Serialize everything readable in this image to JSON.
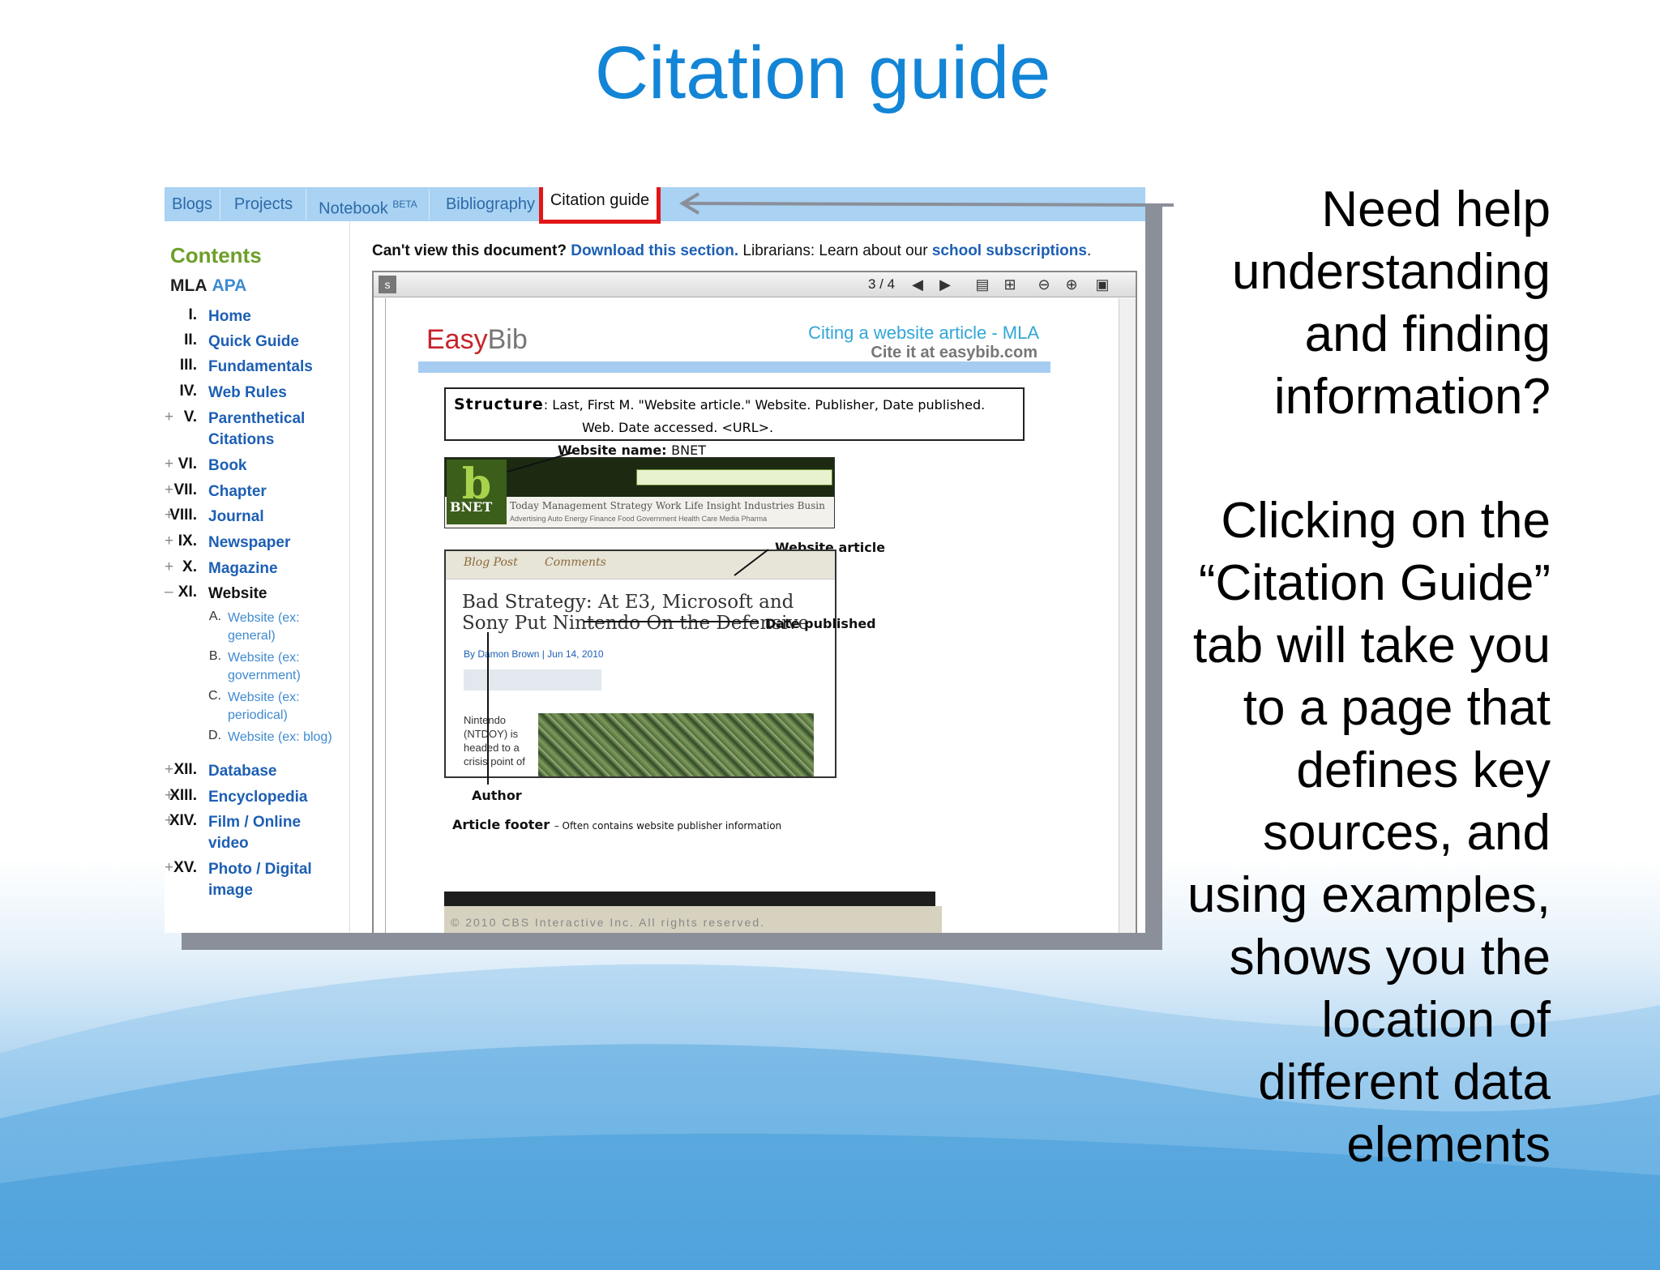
{
  "slide": {
    "title": "Citation guide",
    "side_text_1": [
      "Need help",
      "understanding",
      "and finding",
      "information?"
    ],
    "side_text_2": [
      "Clicking on the",
      "“Citation Guide”",
      "tab will take you",
      "to a page that",
      "defines key",
      "sources, and",
      "using examples,",
      "shows you the",
      "location of",
      "different data",
      "elements"
    ]
  },
  "tabs": [
    {
      "label": "Blogs"
    },
    {
      "label": "Projects"
    },
    {
      "label": "Notebook",
      "badge": "BETA"
    },
    {
      "label": "Bibliography"
    },
    {
      "label": "Citation guide",
      "active": true
    }
  ],
  "sidebar": {
    "heading": "Contents",
    "style_mla": "MLA",
    "style_apa": "APA",
    "items": [
      {
        "num": "I.",
        "label": "Home"
      },
      {
        "num": "II.",
        "label": "Quick Guide"
      },
      {
        "num": "III.",
        "label": "Fundamentals"
      },
      {
        "num": "IV.",
        "label": "Web Rules"
      },
      {
        "num": "V.",
        "label": "Parenthetical Citations"
      },
      {
        "num": "VI.",
        "label": "Book"
      },
      {
        "num": "VII.",
        "label": "Chapter"
      },
      {
        "num": "VIII.",
        "label": "Journal"
      },
      {
        "num": "IX.",
        "label": "Newspaper"
      },
      {
        "num": "X.",
        "label": "Magazine"
      },
      {
        "num": "XI.",
        "label": "Website"
      },
      {
        "num": "XII.",
        "label": "Database"
      },
      {
        "num": "XIII.",
        "label": "Encyclopedia"
      },
      {
        "num": "XIV.",
        "label": "Film / Online video"
      },
      {
        "num": "XV.",
        "label": "Photo / Digital image"
      }
    ],
    "subitems": [
      {
        "num": "A.",
        "label": "Website (ex: general)"
      },
      {
        "num": "B.",
        "label": "Website (ex: government)"
      },
      {
        "num": "C.",
        "label": "Website (ex: periodical)"
      },
      {
        "num": "D.",
        "label": "Website (ex: blog)"
      }
    ]
  },
  "main": {
    "cant_view": "Can't view this document?",
    "download_link": "Download this section.",
    "librarians": "Librarians: Learn about our",
    "subscriptions_link": "school subscriptions",
    "period": "."
  },
  "viewer": {
    "page_indicator": "3 / 4"
  },
  "doc": {
    "logo_easy": "Easy",
    "logo_bib": "Bib",
    "title": "Citing a website article - MLA",
    "subtitle": "Cite it at easybib.com",
    "structure_label": "Structure",
    "structure_line1": ": Last, First M. \"Website article.\" Website. Publisher, Date published.",
    "structure_line2": "Web. Date accessed. <URL>.",
    "ann_website_name": "Website name:",
    "ann_website_name_value": "BNET",
    "ann_website_article": "Website article",
    "ann_date_published": "Date published",
    "ann_author": "Author",
    "ann_article_footer": "Article footer",
    "ann_article_footer_note": "– Often contains website publisher information",
    "bnet_logo": "b",
    "bnet_word": "BNET",
    "bnet_nav": "Today   Management   Strategy   Work Life   Insight   Industries   Busin",
    "bnet_sub": "Advertising   Auto   Energy   Finance   Food   Government   Health Care   Media   Pharma",
    "article_tab_1": "Blog Post",
    "article_tab_2": "Comments",
    "article_title": "Bad Strategy: At E3, Microsoft and Sony Put Nintendo On the Defensive",
    "article_byline": "By Damon Brown | Jun 14, 2010",
    "article_body": "Nintendo (NTDOY) is headed to a crisis point of",
    "footer_text": "© 2010 CBS Interactive Inc. All rights reserved."
  }
}
